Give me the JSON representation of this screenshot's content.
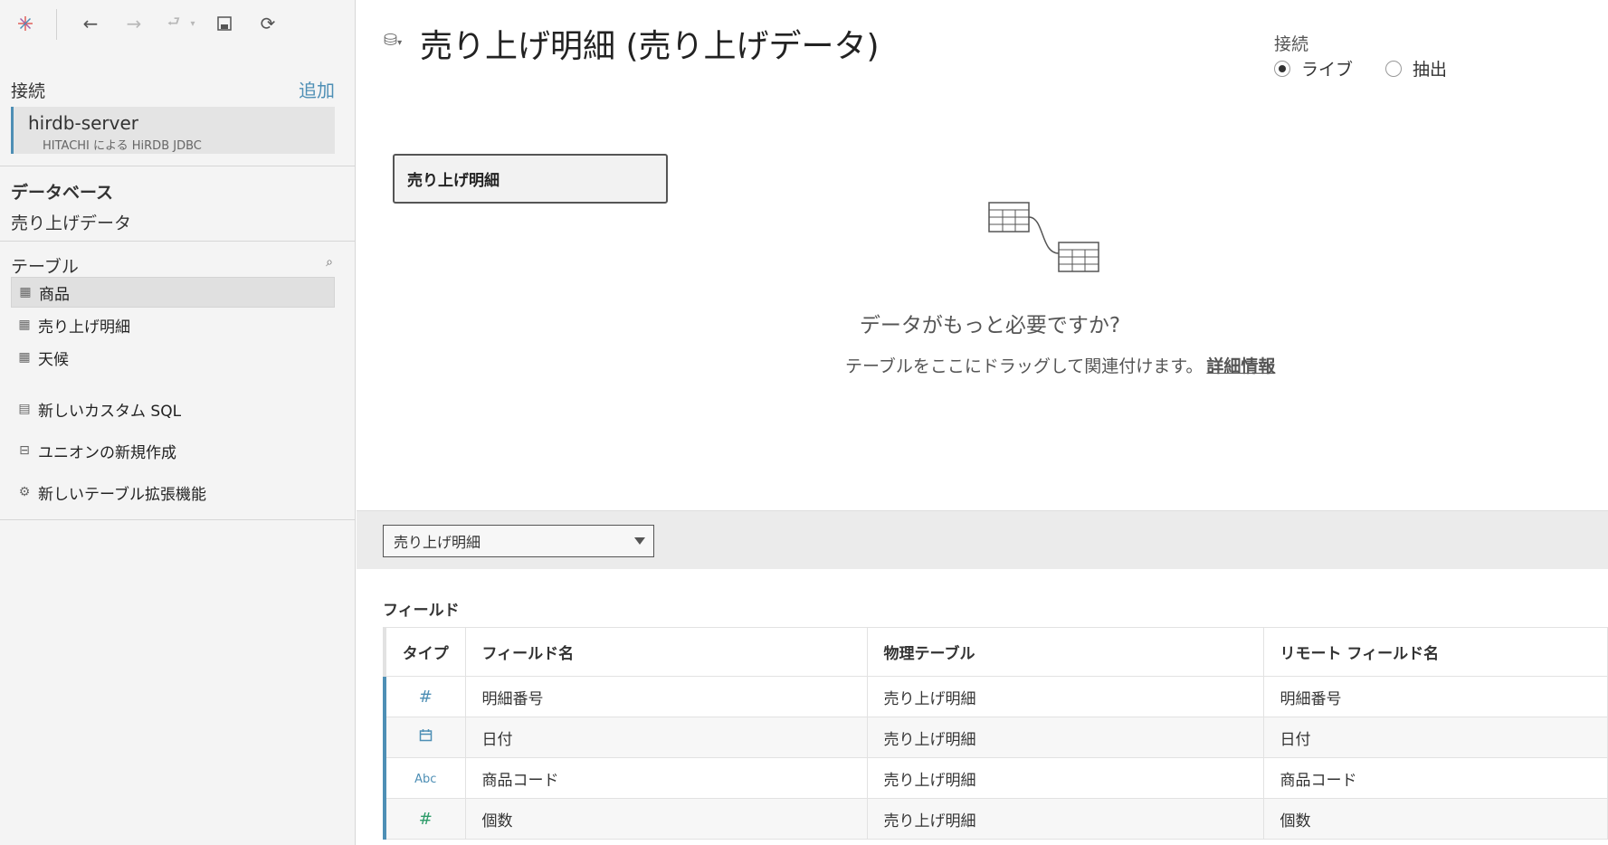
{
  "toolbar": {
    "items": [
      "tableau-logo-icon",
      "back-icon",
      "forward-icon",
      "redo-icon",
      "save-icon",
      "refresh-icon"
    ]
  },
  "sidebar": {
    "connections_label": "接続",
    "add_label": "追加",
    "connection": {
      "name": "hirdb-server",
      "subtitle": "HITACHI による HiRDB JDBC"
    },
    "database_label": "データベース",
    "database_value": "売り上げデータ",
    "tables_label": "テーブル",
    "tables": [
      {
        "label": "商品",
        "selected": true
      },
      {
        "label": "売り上げ明細",
        "selected": false
      },
      {
        "label": "天候",
        "selected": false
      }
    ],
    "actions": [
      {
        "label": "新しいカスタム SQL",
        "icon": "custom-sql-icon"
      },
      {
        "label": "ユニオンの新規作成",
        "icon": "union-icon"
      },
      {
        "label": "新しいテーブル拡張機能",
        "icon": "extension-icon"
      }
    ]
  },
  "main": {
    "title": "売り上げ明細 (売り上げデータ)",
    "connection_type_label": "接続",
    "radio_live": "ライブ",
    "radio_extract": "抽出",
    "selected_connection_type": "live",
    "canvas_table": "売り上げ明細",
    "need_more": "データがもっと必要ですか?",
    "drag_hint": "テーブルをここにドラッグして関連付けます。",
    "learn_more": "詳細情報"
  },
  "grid": {
    "table_select": "売り上げ明細",
    "fields_label": "フィールド",
    "columns": [
      "タイプ",
      "フィールド名",
      "物理テーブル",
      "リモート フィールド名"
    ],
    "rows": [
      {
        "type": "#",
        "type_icon": "number-icon",
        "name": "明細番号",
        "physical": "売り上げ明細",
        "remote": "明細番号"
      },
      {
        "type": "📅",
        "type_icon": "date-icon",
        "name": "日付",
        "physical": "売り上げ明細",
        "remote": "日付"
      },
      {
        "type": "Abc",
        "type_icon": "string-icon",
        "name": "商品コード",
        "physical": "売り上げ明細",
        "remote": "商品コード"
      },
      {
        "type": "#",
        "type_icon": "number-icon",
        "name": "個数",
        "physical": "売り上げ明細",
        "remote": "個数"
      }
    ]
  },
  "colors": {
    "accent": "#4e8fb5",
    "measure_green": "#2e9c6a"
  }
}
